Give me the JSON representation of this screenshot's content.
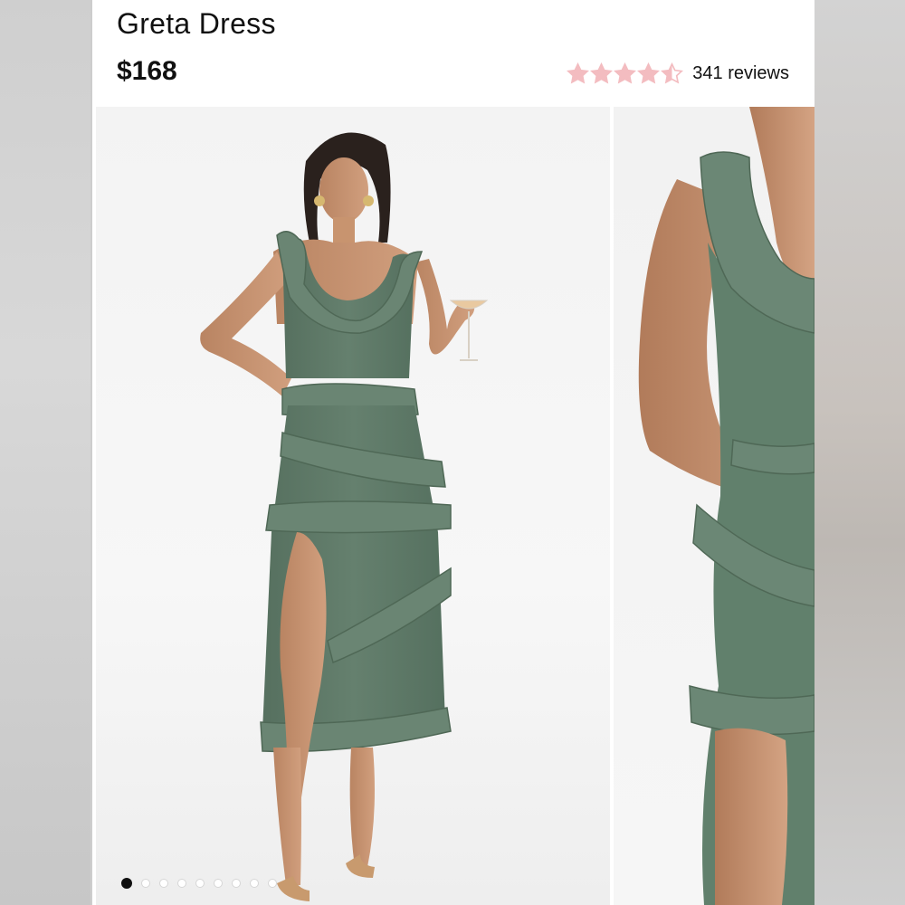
{
  "product": {
    "title": "Greta Dress",
    "price": "$168",
    "rating": {
      "value": 4.5,
      "max": 5,
      "reviews_label": "341 reviews",
      "star_color": "#f3bcc0"
    }
  },
  "gallery": {
    "current_slide": 1,
    "total_slides": 9,
    "images": [
      {
        "name": "model-full-length-photo"
      },
      {
        "name": "model-closeup-photo"
      }
    ]
  },
  "colors": {
    "dress": "#5f7a69",
    "background": "#ffffff"
  }
}
